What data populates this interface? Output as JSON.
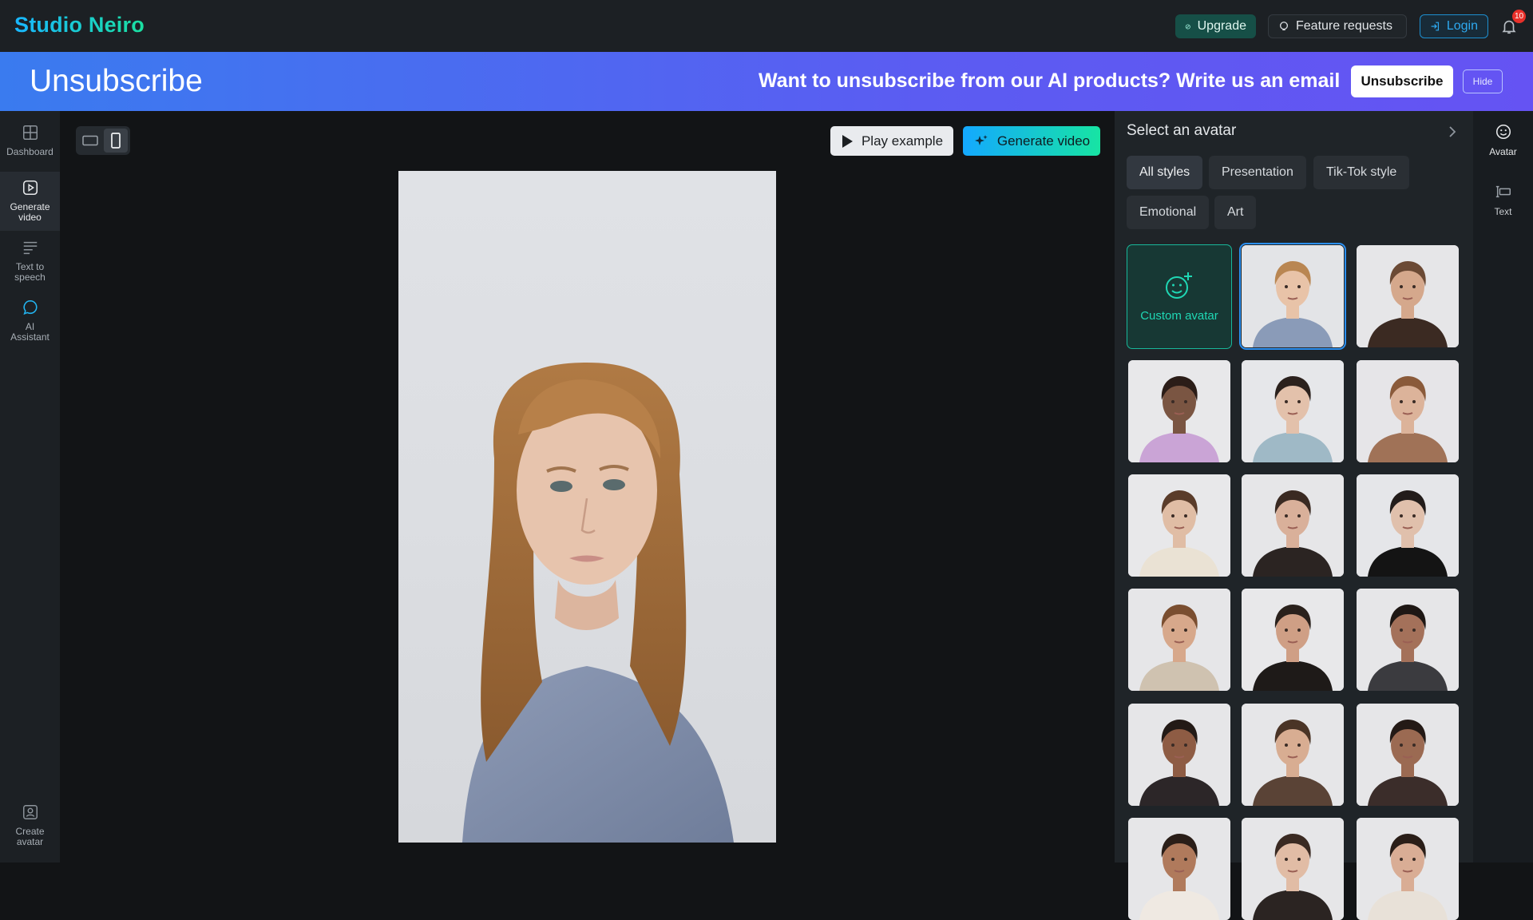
{
  "app": {
    "logo": "Studio Neiro",
    "upgrade_label": "Upgrade",
    "feature_label": "Feature requests",
    "login_label": "Login",
    "notification_count": "10",
    "colors": {
      "brand_start": "#19b6ff",
      "brand_end": "#1ae0a0",
      "banner": "#4f6af0",
      "accent_teal": "#18b89a",
      "selected_outline": "#2b8ff0"
    }
  },
  "banner": {
    "title": "Unsubscribe",
    "message": "Want to unsubscribe from our AI products? Write us an email",
    "unsubscribe_label": "Unsubscribe",
    "hide_label": "Hide"
  },
  "sidebar": {
    "items": [
      {
        "label": "Dashboard",
        "icon": "grid-icon"
      },
      {
        "label": "Generate video",
        "icon": "play-square-icon"
      },
      {
        "label": "Text to speech",
        "icon": "text-lines-icon"
      },
      {
        "label": "AI Assistant",
        "icon": "chat-bubble-icon"
      }
    ],
    "bottom_item": {
      "label": "Create avatar",
      "icon": "user-square-icon"
    }
  },
  "editor": {
    "orientation_options": [
      "landscape",
      "portrait"
    ],
    "orientation_selected": "portrait",
    "play_label": "Play example",
    "generate_label": "Generate video"
  },
  "avatar_panel": {
    "title": "Select an avatar",
    "filters": [
      "All styles",
      "Presentation",
      "Tik-Tok style",
      "Emotional",
      "Art"
    ],
    "selected_filter": "All styles",
    "custom_label": "Custom avatar",
    "selected_avatar_index": 0
  },
  "right_rail": {
    "items": [
      {
        "label": "Avatar",
        "icon": "smile-icon"
      },
      {
        "label": "Text",
        "icon": "text-cursor-icon"
      }
    ]
  }
}
